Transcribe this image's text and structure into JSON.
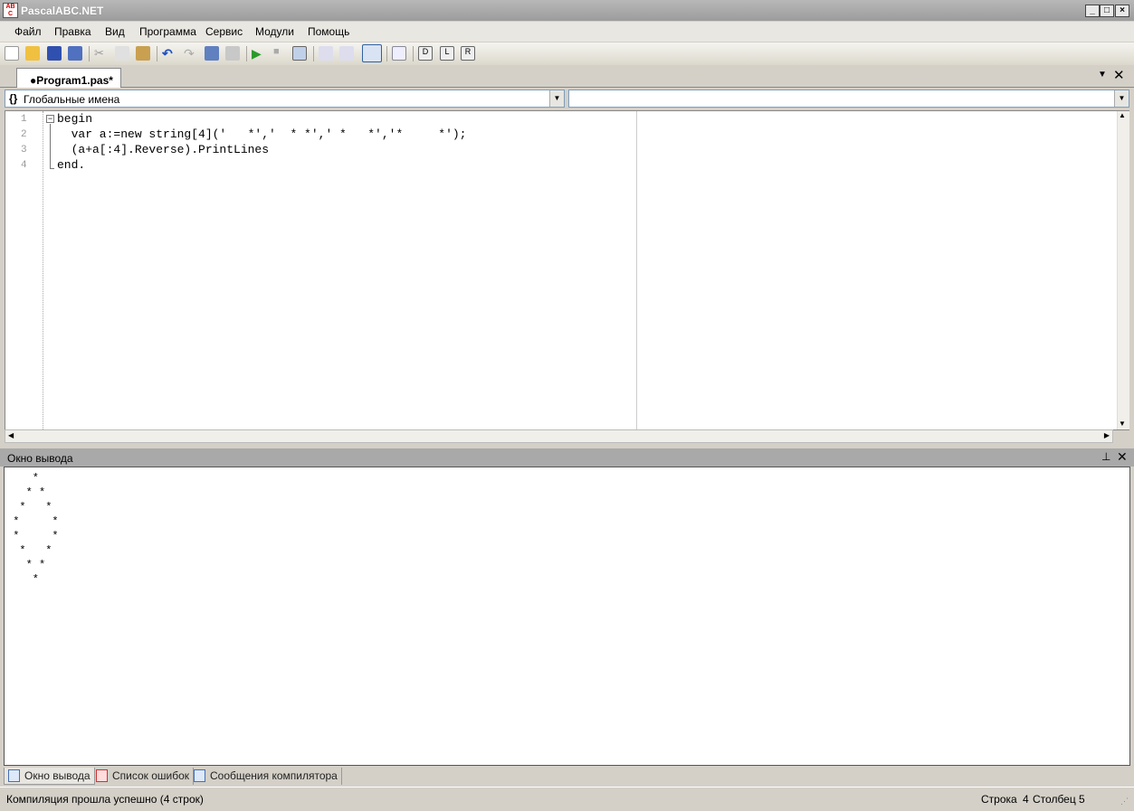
{
  "window": {
    "title": "PascalABC.NET",
    "logo_text": "AB C.NET"
  },
  "menu": [
    "Файл",
    "Правка",
    "Вид",
    "Программа",
    "Сервис",
    "Модули",
    "Помощь"
  ],
  "toolbar_icons": [
    "new-file",
    "open",
    "save",
    "save-all",
    "cut",
    "copy",
    "paste",
    "undo",
    "redo",
    "find",
    "replace",
    "run",
    "stop",
    "compile",
    "step-into",
    "step-over",
    "output-window",
    "debug",
    "goto-def",
    "goto-line",
    "goto-realization"
  ],
  "tab": {
    "label": "●Program1.pas*"
  },
  "scope_combo": {
    "value": "Глобальные имена",
    "icon": "{}"
  },
  "member_combo": {
    "value": ""
  },
  "code": {
    "line_numbers": [
      "1",
      "2",
      "3",
      "4"
    ],
    "lines": [
      "begin",
      "  var a:=new string[4]('   *','  * *',' *   *','*     *');",
      "  (a+a[:4].Reverse).PrintLines",
      "end."
    ]
  },
  "output_panel": {
    "title": "Окно вывода",
    "text": "    *\n   * *\n  *   *\n *     *\n *     *\n  *   *\n   * *\n    *"
  },
  "bottom_tabs": [
    "Окно вывода",
    "Список ошибок",
    "Сообщения компилятора"
  ],
  "status": {
    "message": "Компиляция прошла успешно (4 строк)",
    "row_label": "Строка",
    "row": "4",
    "col_label": "Столбец",
    "col": "5"
  }
}
